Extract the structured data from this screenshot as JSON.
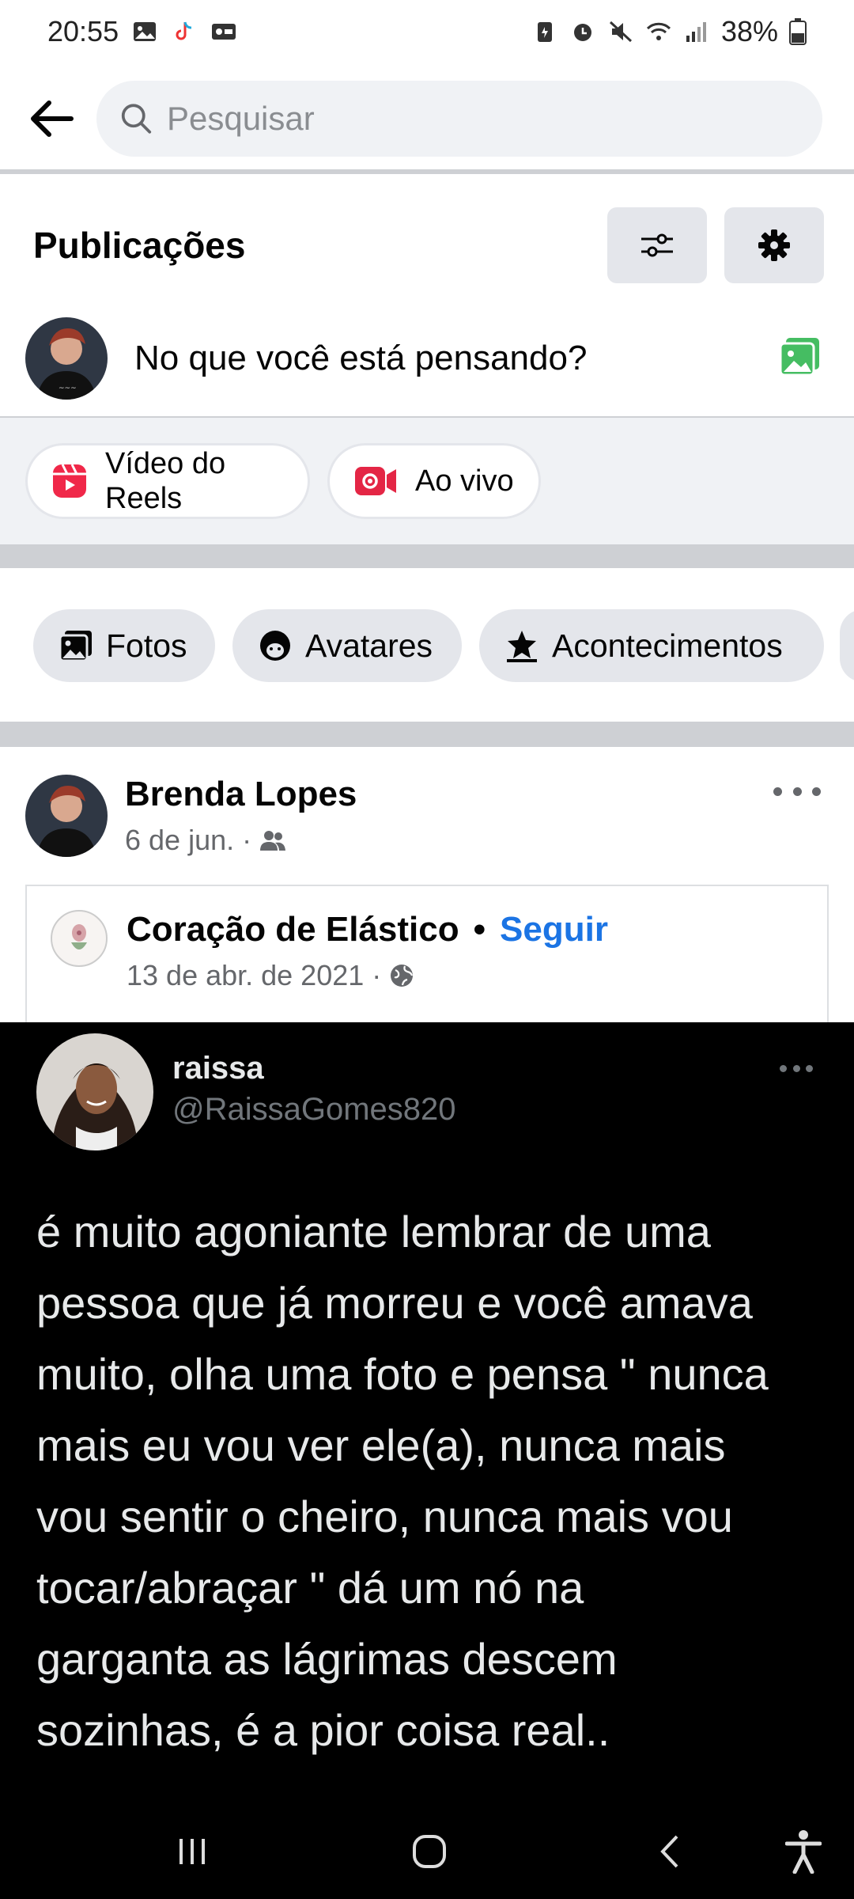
{
  "status_bar": {
    "time": "20:55",
    "battery": "38%"
  },
  "search": {
    "placeholder": "Pesquisar"
  },
  "posts_section": {
    "title": "Publicações",
    "composer_prompt": "No que você está pensando?"
  },
  "create_actions": [
    {
      "label": "Vídeo do Reels",
      "icon": "reels-icon",
      "color": "#f02849"
    },
    {
      "label": "Ao vivo",
      "icon": "live-video-icon",
      "color": "#e42645"
    }
  ],
  "filter_chips": [
    {
      "label": "Fotos",
      "icon": "photos-icon"
    },
    {
      "label": "Avatares",
      "icon": "avatar-icon"
    },
    {
      "label": "Acontecimentos",
      "icon": "star-flag-icon"
    }
  ],
  "post": {
    "author": "Brenda Lopes",
    "date": "6 de jun.",
    "audience_icon": "friends-icon",
    "shared_page": {
      "name": "Coração de Elástico",
      "separator": "•",
      "follow_label": "Seguir",
      "date": "13 de abr. de 2021",
      "audience_icon": "globe-icon"
    },
    "embedded_tweet": {
      "name": "raissa",
      "handle": "@RaissaGomes820",
      "text_lines": [
        "é muito agoniante lembrar de uma",
        "pessoa que já morreu e você amava",
        "muito, olha uma foto e pensa \" nunca",
        "mais eu vou ver ele(a), nunca mais",
        "vou sentir o cheiro, nunca mais vou",
        "tocar/abraçar \" dá um nó na",
        "garganta as lágrimas descem",
        "sozinhas, é a pior coisa real.."
      ]
    }
  },
  "colors": {
    "accent": "#1b74e4",
    "composer_photo": "#45bd62",
    "chip_bg": "#e4e6eb",
    "band": "#f0f2f5"
  }
}
